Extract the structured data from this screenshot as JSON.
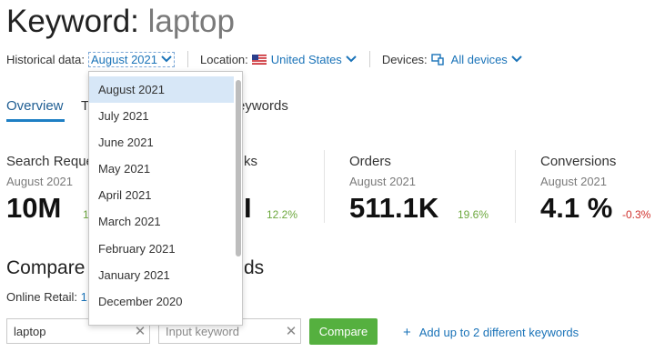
{
  "header": {
    "title_prefix": "Keyword: ",
    "keyword": "laptop"
  },
  "filters": {
    "historical_label": "Historical data:",
    "historical_value": "August 2021",
    "location_label": "Location:",
    "location_value": "United States",
    "devices_label": "Devices:",
    "devices_value": "All devices"
  },
  "tabs": {
    "overview": "Overview",
    "t_partial": "T",
    "keywords_partial": "eywords"
  },
  "cards": [
    {
      "label": "Search Reque",
      "sub": "August 2021",
      "value": "10M",
      "delta": "1",
      "delta_type": "positive"
    },
    {
      "label": "ks",
      "sub": "",
      "value": "I",
      "delta": "12.2%",
      "delta_type": "positive"
    },
    {
      "label": "Orders",
      "sub": "August 2021",
      "value": "511.1K",
      "delta": "19.6%",
      "delta_type": "positive"
    },
    {
      "label": "Conversions",
      "sub": "August 2021",
      "value": "4.1 %",
      "delta": "-0.3%",
      "delta_type": "negative"
    }
  ],
  "compare": {
    "title_left": "Compare",
    "title_right": "ds",
    "online_label": "Online Retail:",
    "online_value": "1",
    "keyword1": "laptop",
    "keyword2_placeholder": "Input keyword",
    "compare_button": "Compare",
    "add_text": "Add up to 2 different keywords",
    "add_icon": "+"
  },
  "dropdown": {
    "selected": "August 2021",
    "options": [
      "August 2021",
      "July 2021",
      "June 2021",
      "May 2021",
      "April 2021",
      "March 2021",
      "February 2021",
      "January 2021",
      "December 2020"
    ]
  },
  "colors": {
    "accent": "#1a73b8",
    "positive": "#6da83e",
    "negative": "#d0312d",
    "button": "#55b03f",
    "selected_row": "#d7e7f7"
  }
}
